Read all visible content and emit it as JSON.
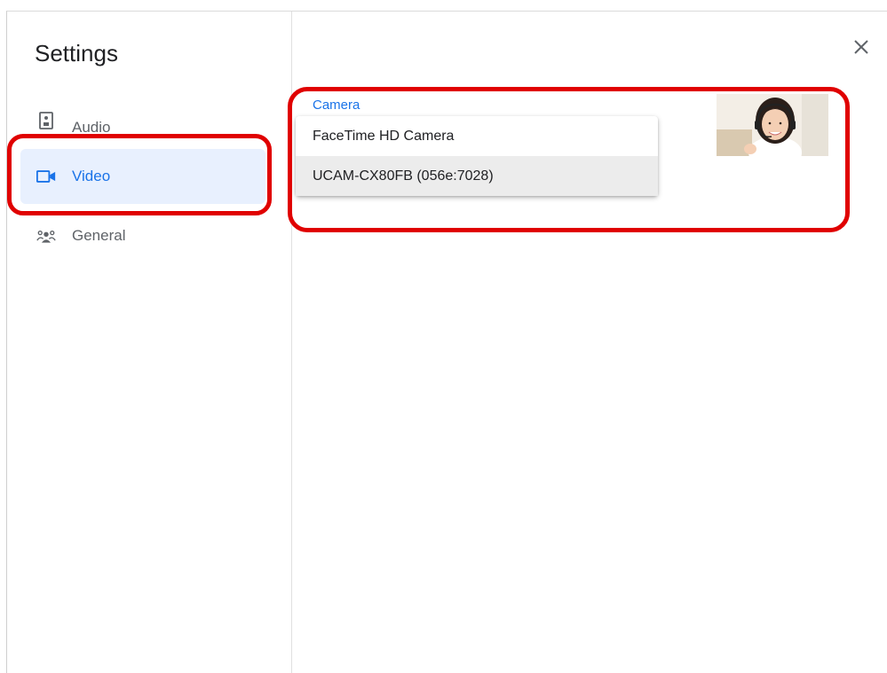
{
  "sidebar": {
    "title": "Settings",
    "items": [
      {
        "label": "Audio",
        "icon": "speaker-icon",
        "active": false
      },
      {
        "label": "Video",
        "icon": "video-camera-icon",
        "active": true
      },
      {
        "label": "General",
        "icon": "people-gear-icon",
        "active": false
      }
    ]
  },
  "camera": {
    "label": "Camera",
    "options": [
      "FaceTime HD Camera",
      "UCAM-CX80FB (056e:7028)"
    ],
    "selected": "UCAM-CX80FB (056e:7028)"
  },
  "colors": {
    "accent": "#1a73e8",
    "active_bg": "#e8f0fe",
    "highlight": "#e00000"
  }
}
